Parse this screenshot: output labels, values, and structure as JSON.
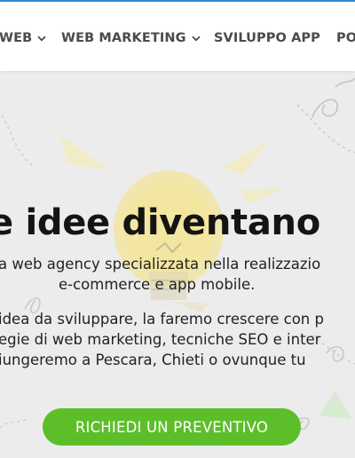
{
  "nav": {
    "items": [
      {
        "label": "WEB",
        "dropdown": true
      },
      {
        "label": "WEB MARKETING",
        "dropdown": true
      },
      {
        "label": "SVILUPPO APP",
        "dropdown": false
      },
      {
        "label": "PO",
        "dropdown": false
      }
    ]
  },
  "hero": {
    "headline": "e idee diventano",
    "subtitle_line1": "a web agency specializzata nella realizzazio",
    "subtitle_line2": "e-commerce e app mobile.",
    "body_line1": "idea da sviluppare, la faremo crescere con p",
    "body_line2": "egie di web marketing, tecniche SEO e inter",
    "body_line3": "iungeremo a Pescara, Chieti o ovunque tu",
    "cta_label": "RICHIEDI UN PREVENTIVO"
  },
  "colors": {
    "accent_green": "#5cbf2a",
    "nav_text": "#4a4a4a",
    "bulb_yellow": "#f5e27a"
  }
}
